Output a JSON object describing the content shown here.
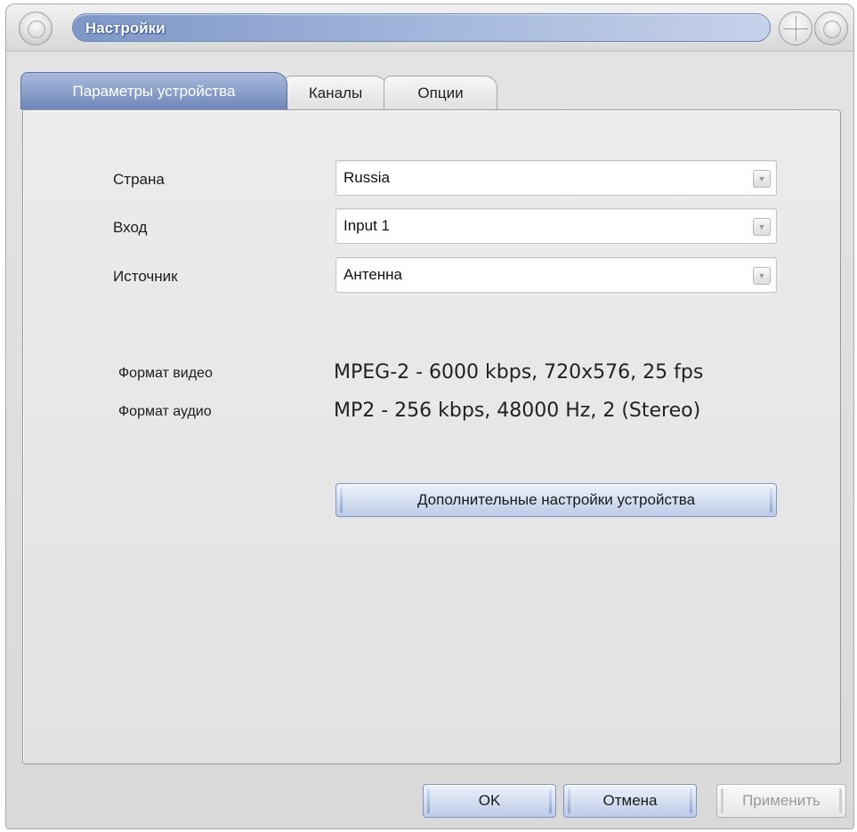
{
  "window": {
    "title": "Настройки"
  },
  "tabs": [
    {
      "label": "Параметры устройства",
      "active": true
    },
    {
      "label": "Каналы",
      "active": false
    },
    {
      "label": "Опции",
      "active": false
    }
  ],
  "device": {
    "country": {
      "label": "Страна",
      "value": "Russia"
    },
    "input": {
      "label": "Вход",
      "value": "Input 1"
    },
    "source": {
      "label": "Источник",
      "value": "Антенна"
    }
  },
  "format": {
    "video": {
      "label": "Формат видео",
      "value": "MPEG-2 - 6000 kbps, 720x576, 25 fps"
    },
    "audio": {
      "label": "Формат аудио",
      "value": "MP2 - 256 kbps, 48000 Hz, 2 (Stereo)"
    }
  },
  "advanced_button": {
    "label": "Дополнительные настройки устройства"
  },
  "footer": {
    "ok_label": "OK",
    "cancel_label": "Отмена",
    "apply_label": "Применить",
    "apply_enabled": false
  },
  "colors": {
    "accent": "#7e97c7",
    "active_tab": "#6e87b9",
    "window_bg": "#e2e2e2"
  },
  "icons": [
    "window-menu-orb-icon",
    "maximize-orb-icon",
    "minimize-orb-icon",
    "chevron-down-icon"
  ]
}
